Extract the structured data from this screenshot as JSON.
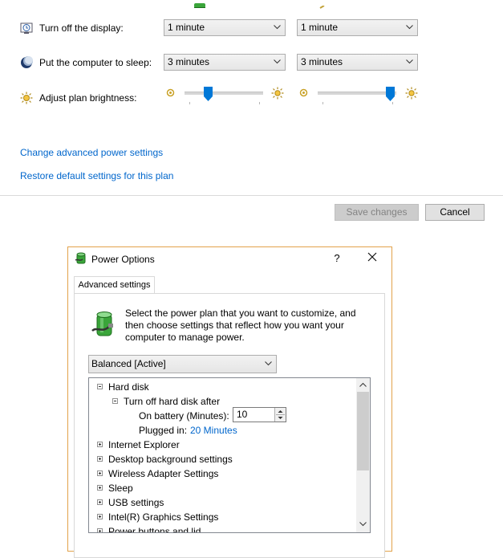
{
  "plan_settings": {
    "display": {
      "label": "Turn off the display:",
      "battery_value": "1 minute",
      "plugged_value": "1 minute"
    },
    "sleep": {
      "label": "Put the computer to sleep:",
      "battery_value": "3 minutes",
      "plugged_value": "3 minutes"
    },
    "brightness": {
      "label": "Adjust plan brightness:",
      "battery_level_fraction": 0.28,
      "plugged_level_fraction": 0.98
    }
  },
  "links": {
    "advanced": "Change advanced power settings",
    "restore": "Restore default settings for this plan"
  },
  "buttons": {
    "save": "Save changes",
    "cancel": "Cancel"
  },
  "dialog": {
    "title": "Power Options",
    "help": "?",
    "tab": "Advanced settings",
    "description": "Select the power plan that you want to customize, and then choose settings that reflect how you want your computer to manage power.",
    "description_lines": [
      "Select the power plan that you want to customize, and",
      "then choose settings that reflect how you want your",
      "computer to manage power."
    ],
    "plan": "Balanced [Active]",
    "tree": {
      "hard_disk": "Hard disk",
      "turn_off_hard_disk": "Turn off hard disk after",
      "on_battery_label": "On battery (Minutes):",
      "on_battery_value": "10",
      "plugged_in_label": "Plugged in:",
      "plugged_in_value": "20 Minutes",
      "categories": [
        "Internet Explorer",
        "Desktop background settings",
        "Wireless Adapter Settings",
        "Sleep",
        "USB settings",
        "Intel(R) Graphics Settings",
        "Power buttons and lid"
      ]
    }
  },
  "colors": {
    "link": "#0066cc",
    "accent": "#0078d7",
    "dialog_border": "#e2a24b"
  }
}
